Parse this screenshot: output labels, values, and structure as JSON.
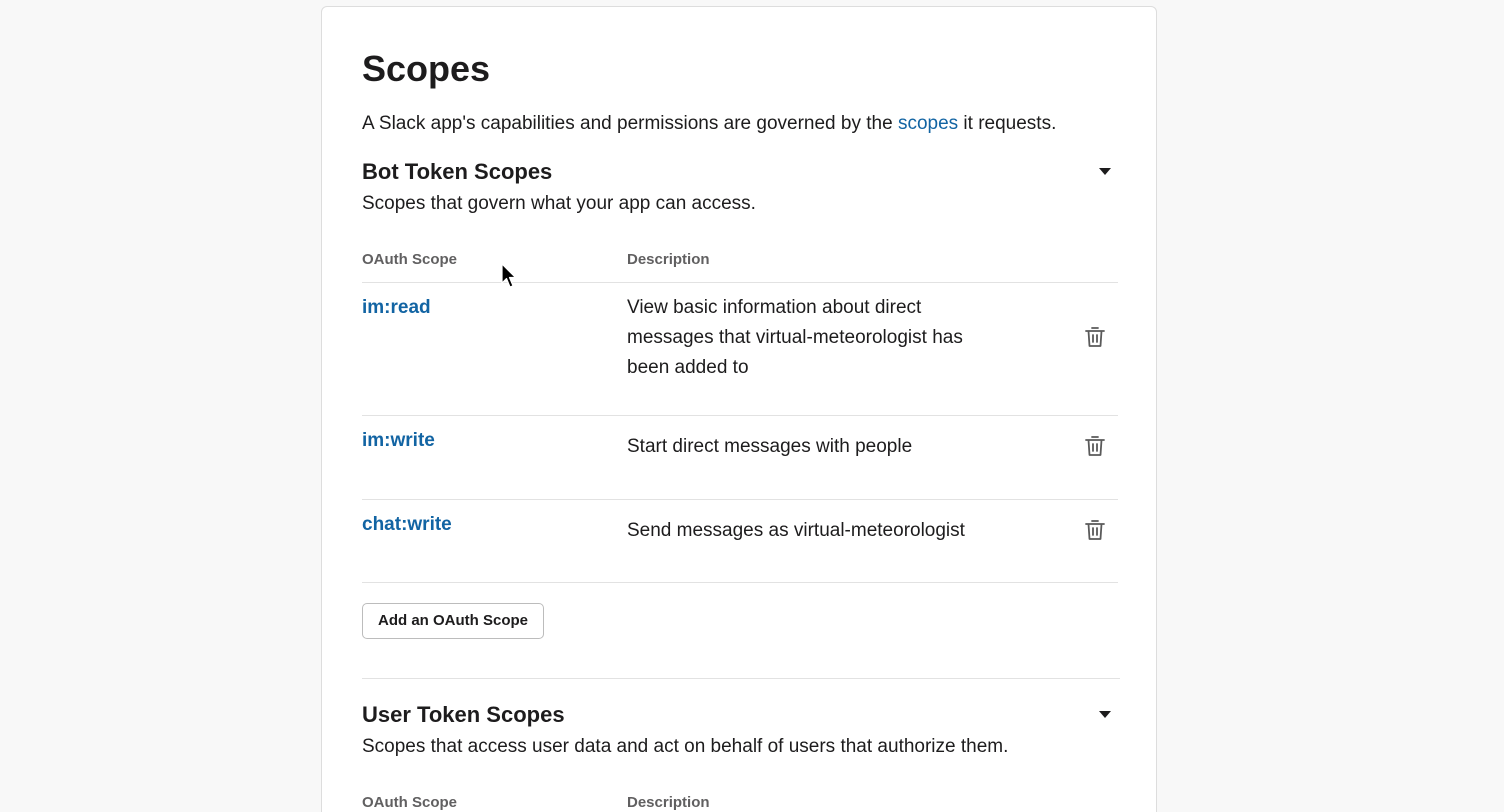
{
  "scopes": {
    "title": "Scopes",
    "intro_before": "A Slack app's capabilities and permissions are governed by the ",
    "intro_link": "scopes",
    "intro_after": " it requests."
  },
  "bot_section": {
    "title": "Bot Token Scopes",
    "subtitle": "Scopes that govern what your app can access.",
    "col_scope": "OAuth Scope",
    "col_description": "Description",
    "rows": [
      {
        "scope": "im:read",
        "description": "View basic information about direct messages that virtual-meteorologist has been added to"
      },
      {
        "scope": "im:write",
        "description": "Start direct messages with people"
      },
      {
        "scope": "chat:write",
        "description": "Send messages as virtual-meteorologist"
      }
    ],
    "add_button": "Add an OAuth Scope"
  },
  "user_section": {
    "title": "User Token Scopes",
    "subtitle": "Scopes that access user data and act on behalf of users that authorize them.",
    "col_scope": "OAuth Scope",
    "col_description": "Description"
  },
  "colors": {
    "link": "#1264a3",
    "text": "#1d1c1d",
    "muted": "#616061"
  }
}
